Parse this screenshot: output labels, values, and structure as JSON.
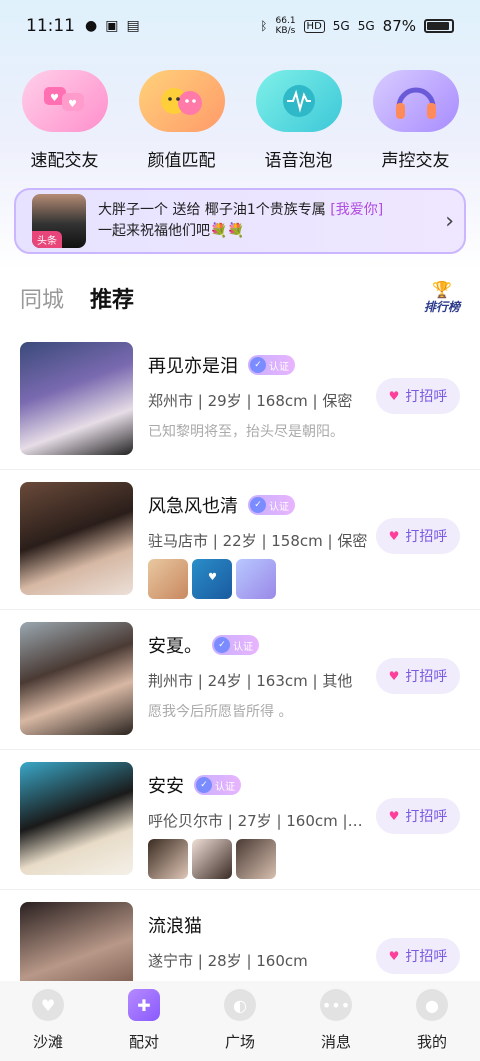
{
  "status_bar": {
    "time": "11:11",
    "net_speed_top": "66.1",
    "net_speed_bottom": "KB/s",
    "hd": "HD",
    "signal1": "5G",
    "signal2": "5G",
    "battery": "87%"
  },
  "features": [
    {
      "label": "速配交友",
      "icon": "chat-hearts-icon"
    },
    {
      "label": "颜值匹配",
      "icon": "faces-icon"
    },
    {
      "label": "语音泡泡",
      "icon": "voice-wave-icon"
    },
    {
      "label": "声控交友",
      "icon": "headphones-icon"
    }
  ],
  "banner": {
    "tag": "头条",
    "text_part1": "大胖子一个 送给 椰子油1个贵族专属 ",
    "highlight": "[我爱你]",
    "text_part2": "一起来祝福他们吧💐💐"
  },
  "tabs": [
    {
      "label": "同城",
      "active": false
    },
    {
      "label": "推荐",
      "active": true
    }
  ],
  "rank_label": "排行榜",
  "verified_label": "认证",
  "greet_label": "打招呼",
  "users": [
    {
      "name": "再见亦是泪",
      "meta": "郑州市 | 29岁 | 168cm | 保密",
      "signature": "已知黎明将至，抬头尽是朝阳。"
    },
    {
      "name": "风急风也清",
      "meta": "驻马店市 | 22岁 | 158cm | 保密"
    },
    {
      "name": "安夏。",
      "meta": "荆州市 | 24岁 | 163cm | 其他",
      "signature": "愿我今后所愿皆所得 。"
    },
    {
      "name": "安安",
      "meta": "呼伦贝尔市 | 27岁 | 160cm |…"
    },
    {
      "name": "流浪猫",
      "meta": "遂宁市 | 28岁 | 160cm"
    }
  ],
  "bottom_nav": [
    {
      "label": "沙滩",
      "icon": "shell-icon"
    },
    {
      "label": "配对",
      "icon": "puzzle-icon",
      "active": true
    },
    {
      "label": "广场",
      "icon": "planet-icon"
    },
    {
      "label": "消息",
      "icon": "message-icon"
    },
    {
      "label": "我的",
      "icon": "profile-icon"
    }
  ]
}
